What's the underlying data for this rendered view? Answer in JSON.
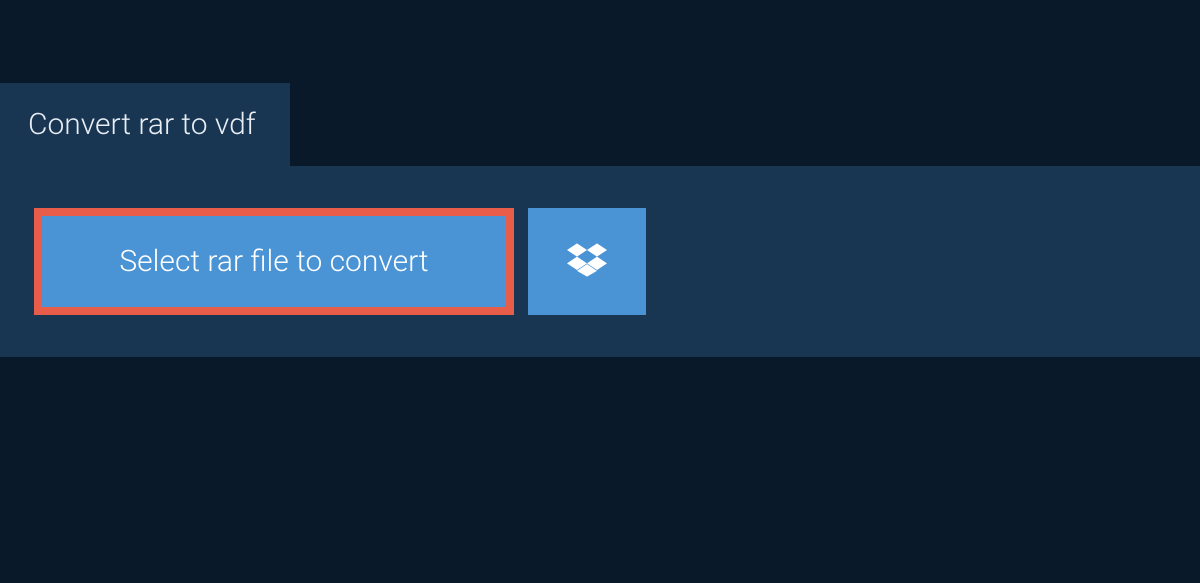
{
  "tab": {
    "title": "Convert rar to vdf"
  },
  "buttons": {
    "select_file_label": "Select rar file to convert"
  }
}
